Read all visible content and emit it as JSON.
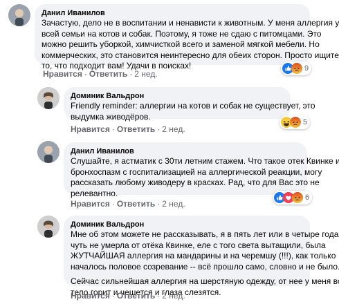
{
  "comments": [
    {
      "author": "Данил Иванилов",
      "lines": [
        "Зачастую, дело не в воспитании и ненависти к животным. У меня аллергия у",
        "всей семьи на котов и собак. Поэтому, я тоже не сдаю с питомцами. Это",
        "можно решить уборкой, химчисткой всего и заменой мягкой мебели. Но",
        "коммерческих, это становится неинтересно для обеих сторон. Просто ищите",
        "то, что подходит вам! Удачи в поисках!"
      ],
      "like_label": "Нравится",
      "reply_label": "Ответить",
      "time": "2 нед.",
      "reactions": [
        "like-icon",
        "angry-icon"
      ],
      "reaction_count": "9"
    },
    {
      "author": "Доминик Вальдрон",
      "lines": [
        "Friendly reminder: аллергии на котов и собак не существует, это",
        "выдумка живодёров."
      ],
      "like_label": "Нравится",
      "reply_label": "Ответить",
      "time": "2 нед.",
      "reactions": [
        "haha-icon",
        "angry-icon"
      ],
      "reaction_count": "5"
    },
    {
      "author": "Данил Иванилов",
      "lines": [
        "Слушайте, я астматик с 30ти летним стажем. Что такое отек Квинке и",
        "бронхоспазм с госпитализацией на аллергической реакции, могу",
        "рассказать любому живодеру в красках. Рад, что для Вас это не",
        "релевантно."
      ],
      "like_label": "Нравится",
      "reply_label": "Ответить",
      "time": "2 нед.",
      "reactions": [
        "like-icon",
        "love-icon",
        "angry-icon"
      ],
      "reaction_count": "6"
    },
    {
      "author": "Доминик Вальдрон",
      "lines": [
        "Мне об этом можете не рассказывать, я в пять лет или в четыре года",
        "чуть не умерла от отёка Квинке, еле с того света вытащили, была",
        "ЖУТЧАЙШАЯ аллергия на мандарины и на черемшу (!!!), как только",
        "началось половое созревание -- всё прошло само, словно и не было."
      ],
      "lines2": [
        "Сейчас сильнейшая аллергия на шерстяную одежду, от нее у меня всё",
        "тело горит и чешется и глаза слезятся."
      ],
      "like_label": "Нравится",
      "reply_label": "Ответить",
      "time": "2 нед."
    }
  ],
  "dot": "·",
  "colors": {
    "bubble": "#f0f2f5",
    "meta": "#65676b",
    "like": "#1877f2",
    "angry": "#e9710f"
  }
}
